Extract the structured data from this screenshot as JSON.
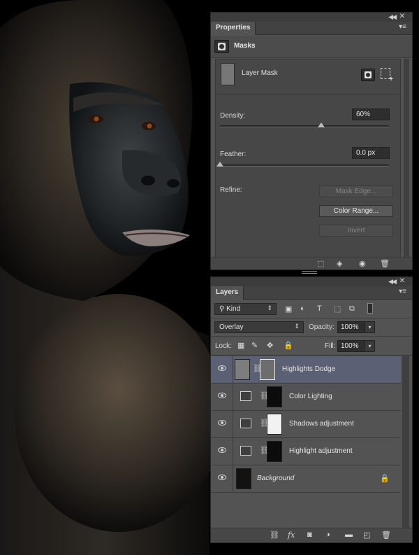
{
  "properties": {
    "tab": "Properties",
    "section_title": "Masks",
    "layer_mask_label": "Layer Mask",
    "density_label": "Density:",
    "density_value": "60%",
    "density_fraction": 0.6,
    "feather_label": "Feather:",
    "feather_value": "0.0 px",
    "feather_fraction": 0.0,
    "refine_label": "Refine:",
    "mask_edge": "Mask Edge...",
    "color_range": "Color Range...",
    "invert": "Invert"
  },
  "layers": {
    "tab": "Layers",
    "kind_filter": "Kind",
    "blend_mode": "Overlay",
    "opacity_label": "Opacity:",
    "opacity_value": "100%",
    "lock_label": "Lock:",
    "fill_label": "Fill:",
    "fill_value": "100%",
    "items": [
      {
        "name": "Highlights Dodge",
        "selected": true
      },
      {
        "name": "Color Lighting"
      },
      {
        "name": "Shadows adjustment"
      },
      {
        "name": "Highlight adjustment"
      },
      {
        "name": "Background",
        "italic": true,
        "locked": true
      }
    ]
  },
  "colors": {
    "panel": "#535353",
    "panel_dark": "#474747",
    "selected_row": "#5c6074"
  }
}
